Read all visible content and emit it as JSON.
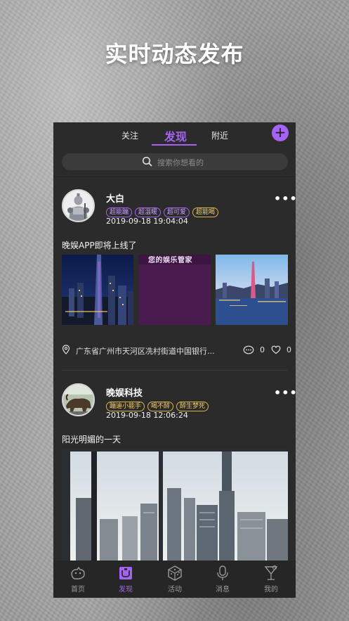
{
  "headline": "实时动态发布",
  "tabs": [
    {
      "label": "关注",
      "active": false
    },
    {
      "label": "发现",
      "active": true
    },
    {
      "label": "附近",
      "active": false
    }
  ],
  "add_button_label": "+",
  "search": {
    "placeholder": "搜索你想看的"
  },
  "posts": [
    {
      "user": "大白",
      "tags": [
        {
          "label": "超能蹦",
          "style": "purple"
        },
        {
          "label": "超温暖",
          "style": "purple"
        },
        {
          "label": "超可爱",
          "style": "purple"
        },
        {
          "label": "超能喝",
          "style": "gold"
        }
      ],
      "time": "2019-09-18 19:04:04",
      "content": "晚娱APP即将上线了",
      "image_caption": "您的娱乐管家",
      "location": "广东省广州市天河区冼村街道中国银行...",
      "comments": "0",
      "likes": "0"
    },
    {
      "user": "晚娱科技",
      "tags": [
        {
          "label": "蹦迪小能手",
          "style": "gold"
        },
        {
          "label": "喝不醉",
          "style": "gold"
        },
        {
          "label": "醉生梦死",
          "style": "gold"
        }
      ],
      "time": "2019-09-18 12:06:24",
      "content": "阳光明媚的一天"
    }
  ],
  "more_label": "•••",
  "bottom_nav": [
    {
      "label": "首页",
      "icon": "home-icon",
      "active": false
    },
    {
      "label": "发现",
      "icon": "discover-icon",
      "active": true
    },
    {
      "label": "活动",
      "icon": "dice-icon",
      "active": false
    },
    {
      "label": "消息",
      "icon": "microphone-icon",
      "active": false
    },
    {
      "label": "我的",
      "icon": "cocktail-icon",
      "active": false
    }
  ],
  "colors": {
    "accent": "#a463f2",
    "gold": "#d9b24a",
    "panel": "#2b2b2b"
  }
}
